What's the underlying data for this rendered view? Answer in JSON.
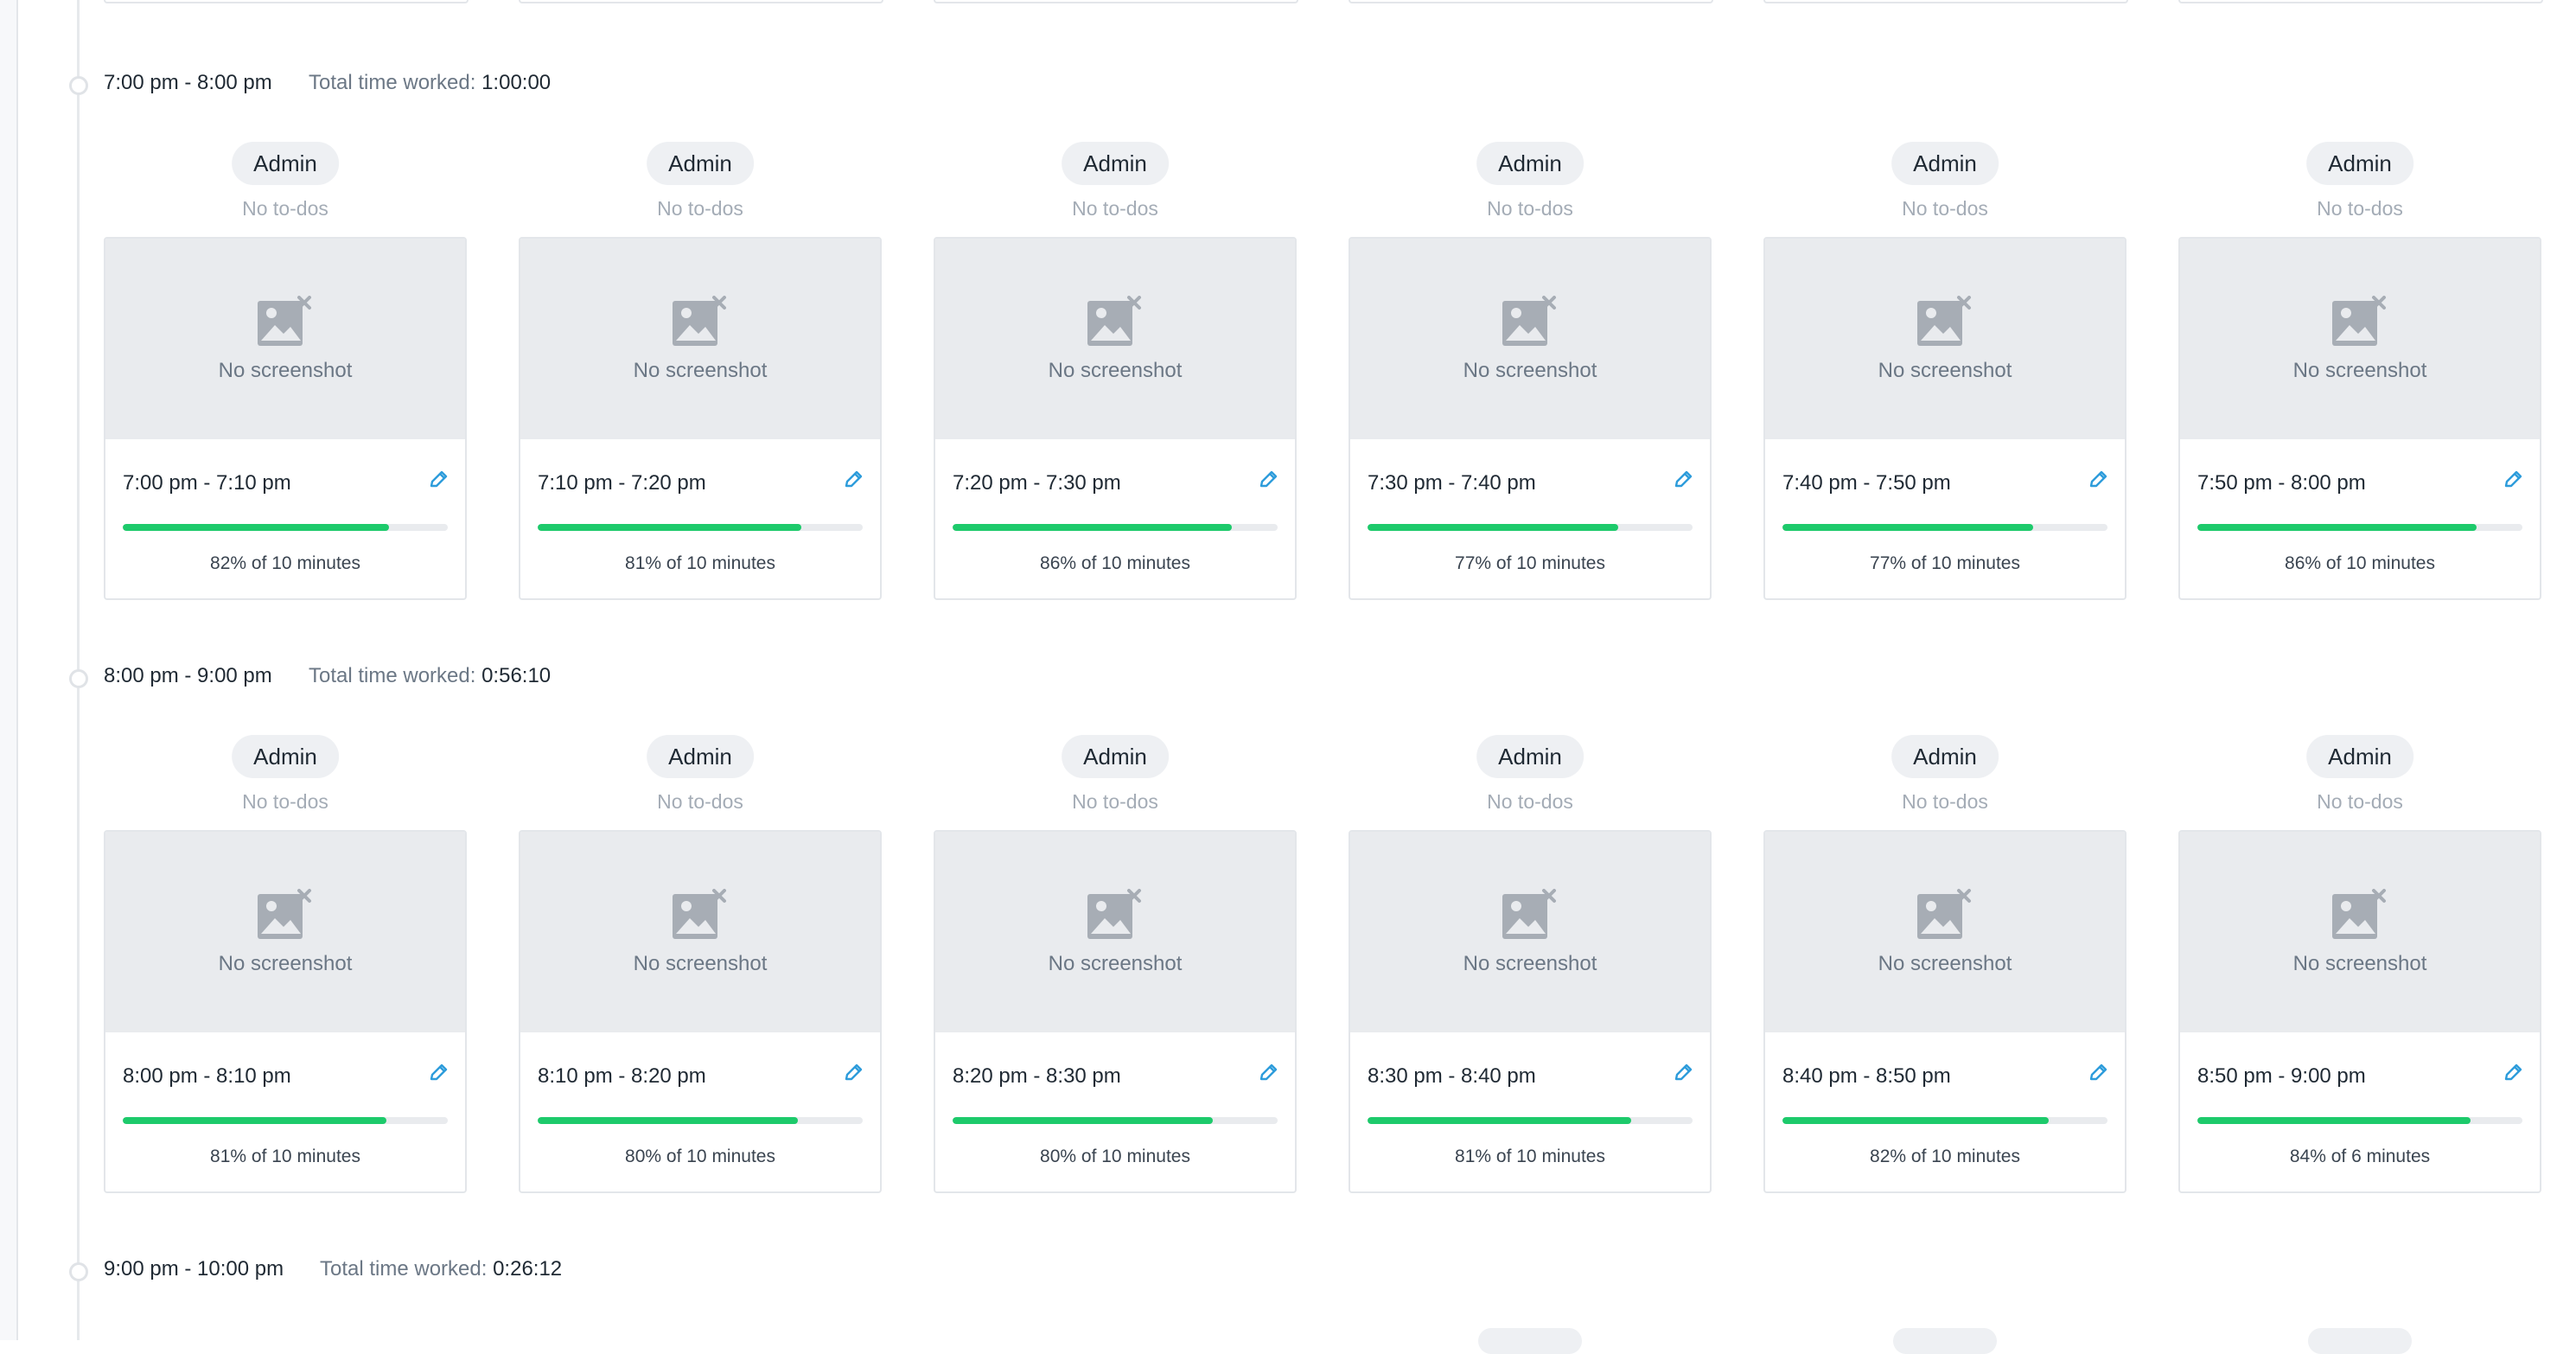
{
  "colors": {
    "accent_progress": "#1dca6b",
    "edit_icon": "#2d9cdb",
    "placeholder_bg": "#e9ebee",
    "pill_bg": "#eef0f3"
  },
  "icons": {
    "screenshot_placeholder": "image-broken-icon",
    "edit": "pencil-icon",
    "timeline": "timeline-dot-icon"
  },
  "hours": [
    {
      "range": "7:00 pm - 8:00 pm",
      "total_label": "Total time worked:",
      "total_value": "1:00:00",
      "slots": [
        {
          "project": "Admin",
          "todos": "No to-dos",
          "screenshot_text": "No screenshot",
          "time": "7:00 pm - 7:10 pm",
          "activity_pct": 82,
          "activity": "82% of 10 minutes"
        },
        {
          "project": "Admin",
          "todos": "No to-dos",
          "screenshot_text": "No screenshot",
          "time": "7:10 pm - 7:20 pm",
          "activity_pct": 81,
          "activity": "81% of 10 minutes"
        },
        {
          "project": "Admin",
          "todos": "No to-dos",
          "screenshot_text": "No screenshot",
          "time": "7:20 pm - 7:30 pm",
          "activity_pct": 86,
          "activity": "86% of 10 minutes"
        },
        {
          "project": "Admin",
          "todos": "No to-dos",
          "screenshot_text": "No screenshot",
          "time": "7:30 pm - 7:40 pm",
          "activity_pct": 77,
          "activity": "77% of 10 minutes"
        },
        {
          "project": "Admin",
          "todos": "No to-dos",
          "screenshot_text": "No screenshot",
          "time": "7:40 pm - 7:50 pm",
          "activity_pct": 77,
          "activity": "77% of 10 minutes"
        },
        {
          "project": "Admin",
          "todos": "No to-dos",
          "screenshot_text": "No screenshot",
          "time": "7:50 pm - 8:00 pm",
          "activity_pct": 86,
          "activity": "86% of 10 minutes"
        }
      ]
    },
    {
      "range": "8:00 pm - 9:00 pm",
      "total_label": "Total time worked:",
      "total_value": "0:56:10",
      "slots": [
        {
          "project": "Admin",
          "todos": "No to-dos",
          "screenshot_text": "No screenshot",
          "time": "8:00 pm - 8:10 pm",
          "activity_pct": 81,
          "activity": "81% of 10 minutes"
        },
        {
          "project": "Admin",
          "todos": "No to-dos",
          "screenshot_text": "No screenshot",
          "time": "8:10 pm - 8:20 pm",
          "activity_pct": 80,
          "activity": "80% of 10 minutes"
        },
        {
          "project": "Admin",
          "todos": "No to-dos",
          "screenshot_text": "No screenshot",
          "time": "8:20 pm - 8:30 pm",
          "activity_pct": 80,
          "activity": "80% of 10 minutes"
        },
        {
          "project": "Admin",
          "todos": "No to-dos",
          "screenshot_text": "No screenshot",
          "time": "8:30 pm - 8:40 pm",
          "activity_pct": 81,
          "activity": "81% of 10 minutes"
        },
        {
          "project": "Admin",
          "todos": "No to-dos",
          "screenshot_text": "No screenshot",
          "time": "8:40 pm - 8:50 pm",
          "activity_pct": 82,
          "activity": "82% of 10 minutes"
        },
        {
          "project": "Admin",
          "todos": "No to-dos",
          "screenshot_text": "No screenshot",
          "time": "8:50 pm - 9:00 pm",
          "activity_pct": 84,
          "activity": "84% of 6 minutes"
        }
      ]
    },
    {
      "range": "9:00 pm - 10:00 pm",
      "total_label": "Total time worked:",
      "total_value": "0:26:12",
      "slots": []
    }
  ]
}
